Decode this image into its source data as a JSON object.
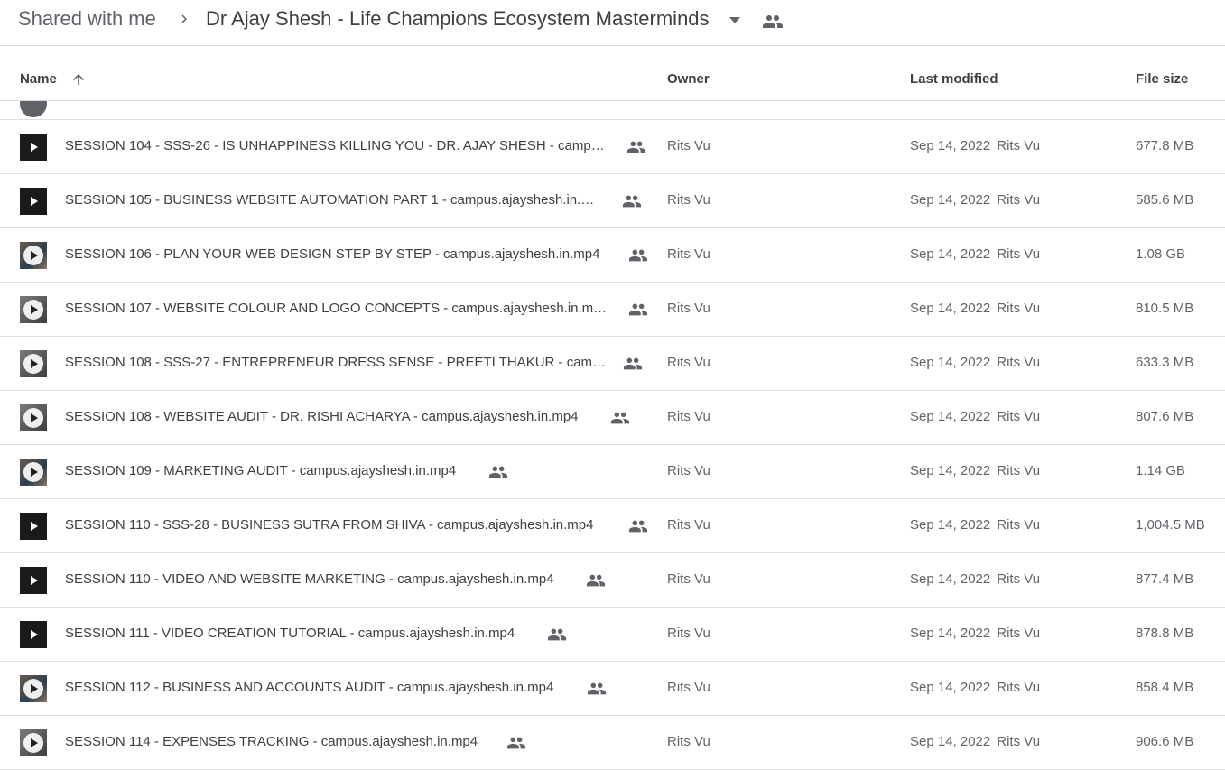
{
  "breadcrumb": {
    "root": "Shared with me",
    "current": "Dr Ajay Shesh - Life Champions Ecosystem Masterminds"
  },
  "columns": {
    "name": "Name",
    "owner": "Owner",
    "modified": "Last modified",
    "size": "File size"
  },
  "icons": {
    "separator": "chevron-right-icon",
    "dropdown": "arrow-drop-down-icon",
    "shared": "people-icon",
    "sort": "arrow-upward-icon",
    "file": "video-play-icon"
  },
  "files": [
    {
      "name": "SESSION 104 - SSS-26 - IS UNHAPPINESS KILLING YOU - DR. AJAY SHESH - camp…",
      "owner": "Rits Vu",
      "modified_date": "Sep 14, 2022",
      "modified_by": "Rits Vu",
      "size": "677.8 MB",
      "thumb": "black"
    },
    {
      "name": "SESSION 105 - BUSINESS WEBSITE AUTOMATION PART 1 - campus.ajayshesh.in.…",
      "owner": "Rits Vu",
      "modified_date": "Sep 14, 2022",
      "modified_by": "Rits Vu",
      "size": "585.6 MB",
      "thumb": "black"
    },
    {
      "name": "SESSION 106 - PLAN YOUR WEB DESIGN STEP BY STEP - campus.ajayshesh.in.mp4",
      "owner": "Rits Vu",
      "modified_date": "Sep 14, 2022",
      "modified_by": "Rits Vu",
      "size": "1.08 GB",
      "thumb": "photo"
    },
    {
      "name": "SESSION 107 - WEBSITE COLOUR AND LOGO CONCEPTS - campus.ajayshesh.in.m…",
      "owner": "Rits Vu",
      "modified_date": "Sep 14, 2022",
      "modified_by": "Rits Vu",
      "size": "810.5 MB",
      "thumb": "gray"
    },
    {
      "name": "SESSION 108 - SSS-27 - ENTREPRENEUR DRESS SENSE - PREETI THAKUR - camp…",
      "owner": "Rits Vu",
      "modified_date": "Sep 14, 2022",
      "modified_by": "Rits Vu",
      "size": "633.3 MB",
      "thumb": "gray"
    },
    {
      "name": "SESSION 108 - WEBSITE AUDIT - DR. RISHI ACHARYA - campus.ajayshesh.in.mp4",
      "owner": "Rits Vu",
      "modified_date": "Sep 14, 2022",
      "modified_by": "Rits Vu",
      "size": "807.6 MB",
      "thumb": "gray"
    },
    {
      "name": "SESSION 109 - MARKETING AUDIT - campus.ajayshesh.in.mp4",
      "owner": "Rits Vu",
      "modified_date": "Sep 14, 2022",
      "modified_by": "Rits Vu",
      "size": "1.14 GB",
      "thumb": "photo"
    },
    {
      "name": "SESSION 110 - SSS-28 - BUSINESS SUTRA FROM SHIVA - campus.ajayshesh.in.mp4",
      "owner": "Rits Vu",
      "modified_date": "Sep 14, 2022",
      "modified_by": "Rits Vu",
      "size": "1,004.5 MB",
      "thumb": "black"
    },
    {
      "name": "SESSION 110 - VIDEO AND WEBSITE MARKETING - campus.ajayshesh.in.mp4",
      "owner": "Rits Vu",
      "modified_date": "Sep 14, 2022",
      "modified_by": "Rits Vu",
      "size": "877.4 MB",
      "thumb": "black"
    },
    {
      "name": "SESSION 111 - VIDEO CREATION TUTORIAL - campus.ajayshesh.in.mp4",
      "owner": "Rits Vu",
      "modified_date": "Sep 14, 2022",
      "modified_by": "Rits Vu",
      "size": "878.8 MB",
      "thumb": "black"
    },
    {
      "name": "SESSION 112 - BUSINESS AND ACCOUNTS AUDIT - campus.ajayshesh.in.mp4",
      "owner": "Rits Vu",
      "modified_date": "Sep 14, 2022",
      "modified_by": "Rits Vu",
      "size": "858.4 MB",
      "thumb": "photo"
    },
    {
      "name": "SESSION 114 - EXPENSES TRACKING - campus.ajayshesh.in.mp4",
      "owner": "Rits Vu",
      "modified_date": "Sep 14, 2022",
      "modified_by": "Rits Vu",
      "size": "906.6 MB",
      "thumb": "gray"
    }
  ]
}
